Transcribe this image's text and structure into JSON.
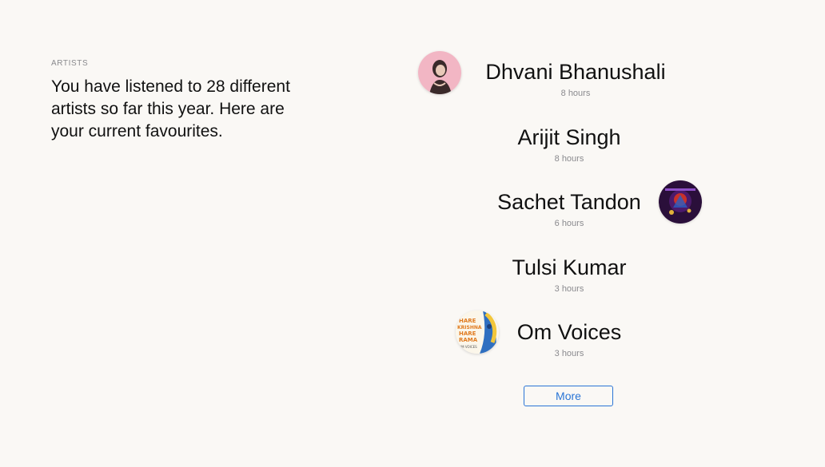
{
  "section_label": "ARTISTS",
  "headline": "You have listened to 28 different artists so far this year. Here are your current favourites.",
  "artists": [
    {
      "name": "Dhvani Bhanushali",
      "hours": "8 hours"
    },
    {
      "name": "Arijit Singh",
      "hours": "8 hours"
    },
    {
      "name": "Sachet Tandon",
      "hours": "6 hours"
    },
    {
      "name": "Tulsi Kumar",
      "hours": "3 hours"
    },
    {
      "name": "Om Voices",
      "hours": "3 hours"
    }
  ],
  "cover_art_text": {
    "line1": "HARE",
    "line2": "KRISHNA",
    "line3": "HARE",
    "line4": "RAMA",
    "credit": "OM VOICES"
  },
  "more_label": "More",
  "colors": {
    "background": "#faf8f5",
    "accent": "#2a75d6",
    "muted": "#8a8a8e"
  }
}
